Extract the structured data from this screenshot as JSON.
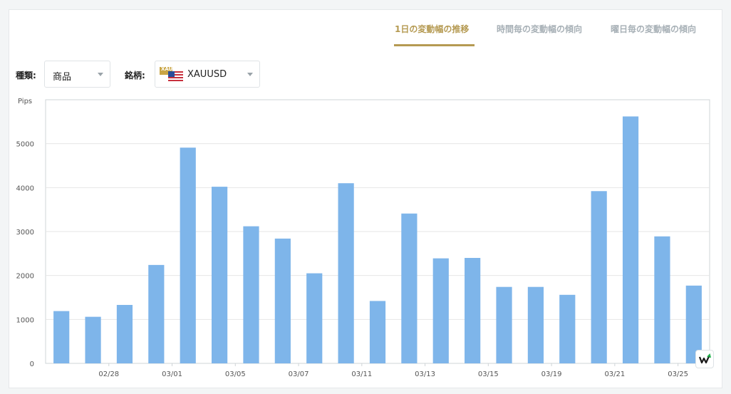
{
  "tabs": [
    {
      "label": "1日の変動幅の推移",
      "active": true
    },
    {
      "label": "時間毎の変動幅の傾向",
      "active": false
    },
    {
      "label": "曜日毎の変動幅の傾向",
      "active": false
    }
  ],
  "filters": {
    "type_label": "種類:",
    "type_value": "商品",
    "symbol_label": "銘柄:",
    "symbol_value": "XAUUSD",
    "symbol_icon_text": "XAU"
  },
  "colors": {
    "bar": "#7eb5ea",
    "accent": "#b59a52",
    "grid": "#e6e6e6"
  },
  "chart_data": {
    "type": "bar",
    "ylabel": "Pips",
    "ylim": [
      0,
      6000
    ],
    "yticks": [
      0,
      1000,
      2000,
      3000,
      4000,
      5000
    ],
    "values": [
      1190,
      1060,
      1330,
      2240,
      4910,
      4020,
      3120,
      2840,
      2050,
      4100,
      1420,
      3410,
      2390,
      2400,
      1740,
      1740,
      1560,
      3920,
      5620,
      2890,
      1770
    ],
    "x_tick_labels": [
      {
        "index": 2,
        "label": "02/28"
      },
      {
        "index": 4,
        "label": "03/01"
      },
      {
        "index": 6,
        "label": "03/05"
      },
      {
        "index": 8,
        "label": "03/07"
      },
      {
        "index": 10,
        "label": "03/11"
      },
      {
        "index": 12,
        "label": "03/13"
      },
      {
        "index": 14,
        "label": "03/15"
      },
      {
        "index": 16,
        "label": "03/19"
      },
      {
        "index": 18,
        "label": "03/21"
      },
      {
        "index": 20,
        "label": "03/25"
      }
    ],
    "grid": true,
    "legend": "none"
  }
}
